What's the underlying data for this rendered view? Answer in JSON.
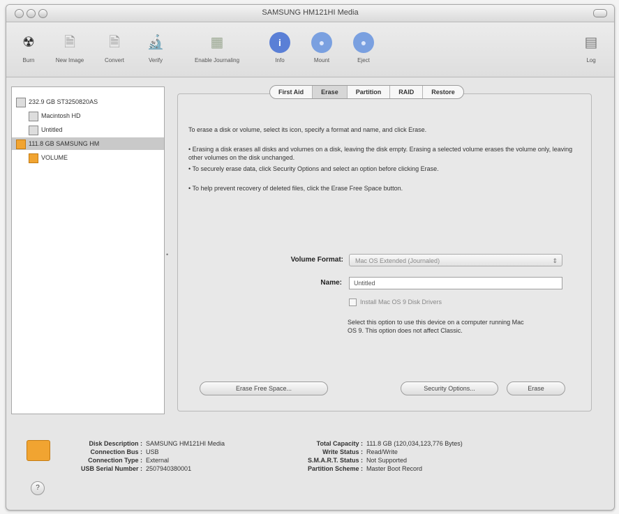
{
  "window": {
    "title": "SAMSUNG HM121HI Media"
  },
  "toolbar": {
    "items": [
      {
        "label": "Burn",
        "icon": "burn-icon",
        "glyph": "☢"
      },
      {
        "label": "New Image",
        "icon": "new-image-icon",
        "glyph": "🗎"
      },
      {
        "label": "Convert",
        "icon": "convert-icon",
        "glyph": "🗎"
      },
      {
        "label": "Verify",
        "icon": "microscope-icon",
        "glyph": "🔬"
      },
      {
        "label": "Enable Journaling",
        "icon": "journal-icon",
        "glyph": "▦"
      },
      {
        "label": "Info",
        "icon": "info-icon",
        "glyph": "i"
      },
      {
        "label": "Mount",
        "icon": "mount-icon",
        "glyph": "●"
      },
      {
        "label": "Eject",
        "icon": "eject-icon",
        "glyph": "●"
      },
      {
        "label": "Log",
        "icon": "log-icon",
        "glyph": "▤"
      }
    ]
  },
  "sidebar": {
    "items": [
      {
        "label": "232.9 GB ST3250820AS",
        "indent": 0
      },
      {
        "label": "Macintosh HD",
        "indent": 1
      },
      {
        "label": "Untitled",
        "indent": 1
      },
      {
        "label": "111.8 GB SAMSUNG HM",
        "indent": 0
      },
      {
        "label": "VOLUME",
        "indent": 1
      }
    ]
  },
  "tabs": [
    "First Aid",
    "Erase",
    "Partition",
    "RAID",
    "Restore"
  ],
  "erase": {
    "instructions": "To erase a disk or volume, select its icon, specify a format and name, and click Erase.",
    "bullet1": "• Erasing a disk erases all disks and volumes on a disk, leaving the disk empty. Erasing a selected volume erases the volume only, leaving other volumes on the disk unchanged.",
    "bullet2": "• To securely erase data, click Security Options and select an option before clicking Erase.",
    "bullet3": "• To help prevent recovery of deleted files, click the Erase Free Space button.",
    "format_label": "Volume Format:",
    "format_value": "Mac OS Extended (Journaled)",
    "name_label": "Name:",
    "name_value": "Untitled",
    "checkbox_label": "Install Mac OS 9 Disk Drivers",
    "help_text": "Select this option to use this device on a computer running Mac OS 9. This option does not affect Classic.",
    "erase_free_space_label": "Erase Free Space...",
    "security_options_label": "Security Options...",
    "erase_label": "Erase"
  },
  "info": {
    "disk_description_label": "Disk Description :",
    "disk_description_value": "SAMSUNG HM121HI Media",
    "connection_bus_label": "Connection Bus :",
    "connection_bus_value": "USB",
    "connection_type_label": "Connection Type :",
    "connection_type_value": "External",
    "serial_label": "USB Serial Number :",
    "serial_value": "2507940380001",
    "total_capacity_label": "Total Capacity :",
    "total_capacity_value": "111.8 GB (120,034,123,776 Bytes)",
    "write_status_label": "Write Status :",
    "write_status_value": "Read/Write",
    "smart_label": "S.M.A.R.T. Status :",
    "smart_value": "Not Supported",
    "partition_label": "Partition Scheme :",
    "partition_value": "Master Boot Record"
  },
  "help_glyph": "?"
}
